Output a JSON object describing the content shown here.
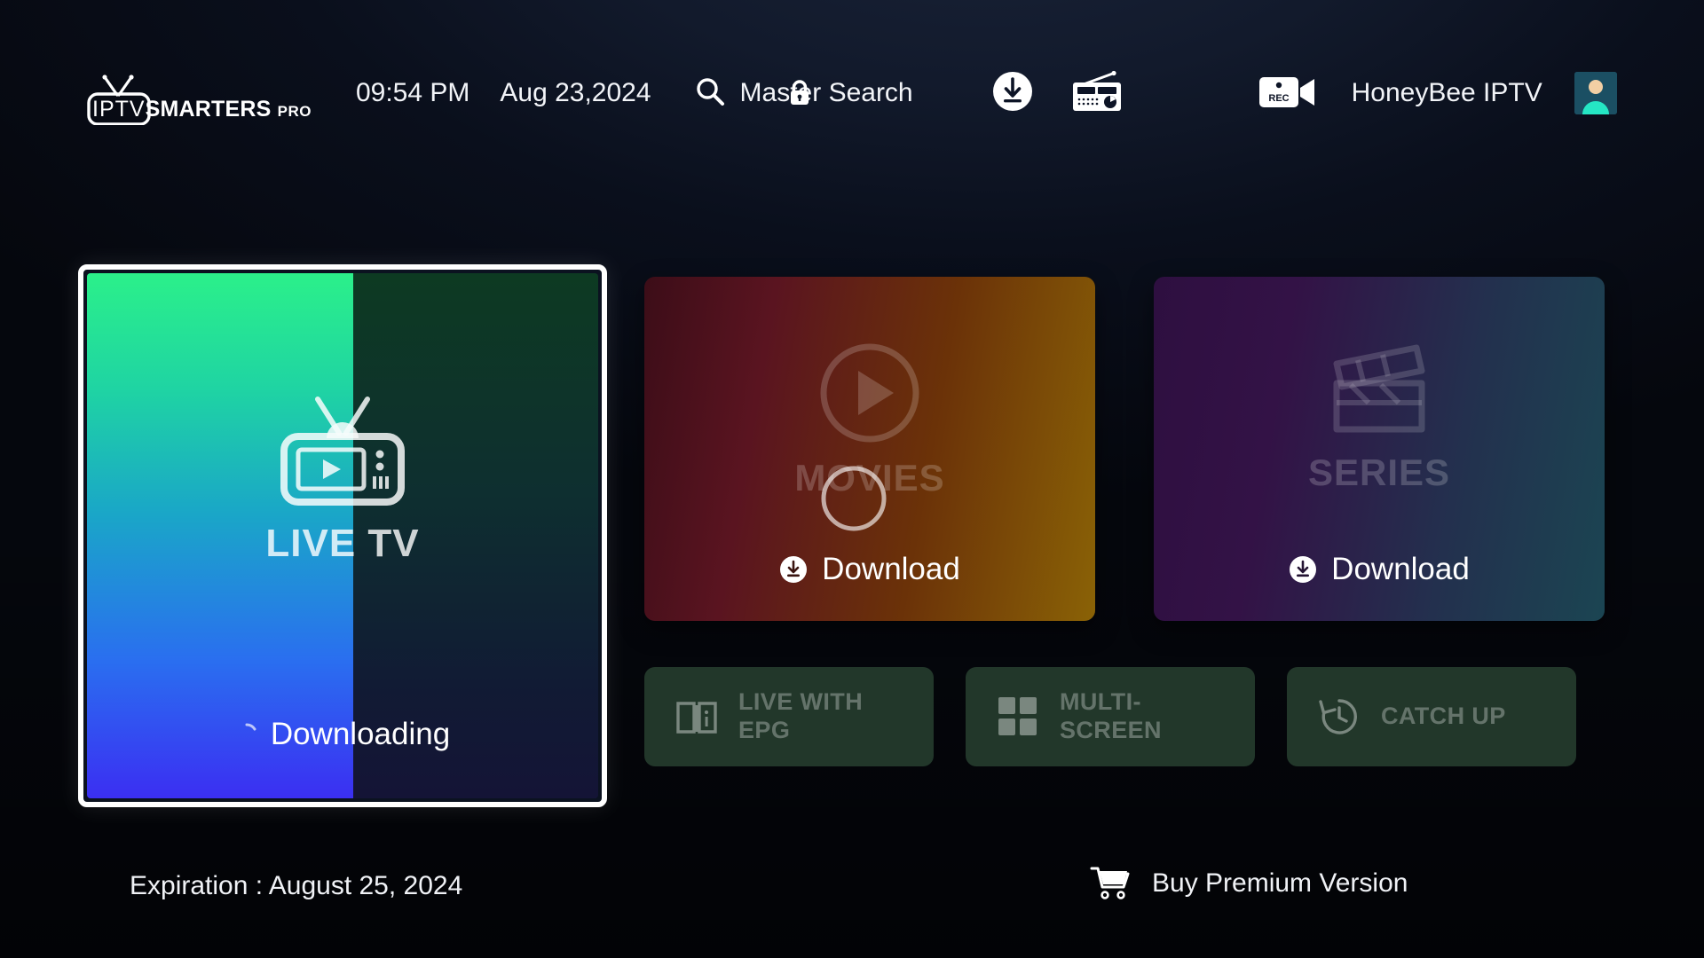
{
  "app": {
    "logo_iptv": "IPTV",
    "logo_smarters": "SMARTERS",
    "logo_pro": "PRO",
    "logo_icon": "tv-antenna-icon"
  },
  "header": {
    "time": "09:54 PM",
    "date": "Aug 23,2024",
    "search_label": "Master Search",
    "search_icon": "search-icon",
    "lock_icon": "lock-icon",
    "download_icon": "download-circle-icon",
    "radio_icon": "radio-icon",
    "rec_icon": "rec-camera-icon",
    "rec_badge": "REC",
    "account_name": "HoneyBee IPTV",
    "avatar_icon": "user-avatar-icon"
  },
  "main": {
    "live_tv": {
      "label": "LIVE TV",
      "status": "Downloading",
      "icon": "live-tv-icon",
      "spinner_icon": "loading-spinner-icon",
      "focused": true,
      "progress_percent": 52
    },
    "tiles": [
      {
        "id": "movies",
        "label": "MOVIES",
        "icon": "play-circle-icon",
        "download_label": "Download",
        "download_icon": "download-circle-icon",
        "spinner_icon": "loading-spinner-icon",
        "has_spinner": true
      },
      {
        "id": "series",
        "label": "SERIES",
        "icon": "clapperboard-icon",
        "download_label": "Download",
        "download_icon": "download-circle-icon",
        "has_spinner": false
      }
    ],
    "actions": [
      {
        "id": "epg",
        "label": "LIVE WITH EPG",
        "icon": "book-info-icon"
      },
      {
        "id": "multi",
        "label": "MULTI-SCREEN",
        "icon": "grid-four-icon"
      },
      {
        "id": "catch",
        "label": "CATCH UP",
        "icon": "history-clock-icon"
      }
    ]
  },
  "footer": {
    "expiration": "Expiration : August 25, 2024",
    "buy_premium": "Buy Premium Version",
    "cart_icon": "shopping-cart-icon"
  },
  "colors": {
    "background": "#05070d",
    "focus_border": "#ffffff",
    "live_green": "#2bf08a",
    "live_blue": "#3b2ff2",
    "movies_red": "#5a1420",
    "movies_amber": "#8a6206",
    "series_purple": "#2e0f40",
    "series_teal": "#1b4552",
    "action_green": "#22372a",
    "text_primary": "#f2f4f8"
  }
}
